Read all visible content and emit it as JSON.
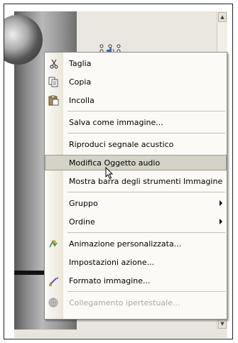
{
  "menu": {
    "items": [
      {
        "label": "Taglia",
        "icon": "scissors-icon",
        "enabled": true
      },
      {
        "label": "Copia",
        "icon": "copy-icon",
        "enabled": true
      },
      {
        "label": "Incolla",
        "icon": "paste-icon",
        "enabled": true
      },
      {
        "label": "Salva come immagine...",
        "icon": "",
        "enabled": true
      },
      {
        "label": "Riproduci segnale acustico",
        "icon": "",
        "enabled": true
      },
      {
        "label": "Modifica Oggetto audio",
        "icon": "",
        "enabled": true,
        "highlighted": true
      },
      {
        "label": "Mostra barra degli strumenti Immagine",
        "icon": "",
        "enabled": true
      },
      {
        "label": "Gruppo",
        "icon": "",
        "enabled": true,
        "submenu": true
      },
      {
        "label": "Ordine",
        "icon": "",
        "enabled": true,
        "submenu": true
      },
      {
        "label": "Animazione personalizzata...",
        "icon": "custom-animation-icon",
        "enabled": true
      },
      {
        "label": "Impostazioni azione...",
        "icon": "",
        "enabled": true
      },
      {
        "label": "Formato immagine...",
        "icon": "format-picture-icon",
        "enabled": true
      },
      {
        "label": "Collegamento ipertestuale...",
        "icon": "hyperlink-globe-icon",
        "enabled": false
      }
    ]
  },
  "colors": {
    "highlight_bg": "#d5d2c8",
    "disabled_text": "#a9a9a9",
    "menu_bg": "#fbfaf6"
  }
}
